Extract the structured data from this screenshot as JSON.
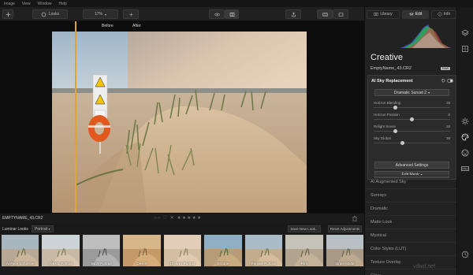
{
  "menu": [
    "Image",
    "View",
    "Window",
    "Help"
  ],
  "toolbar": {
    "looks_label": "Looks",
    "zoom_value": "17%"
  },
  "canvas": {
    "before_label": "Before",
    "after_label": "After"
  },
  "infobar": {
    "filename": "EMPTYNAME_43.CR2",
    "stars": "○– ♡ ✕ ★★★★★"
  },
  "looks": {
    "title": "Luminar Looks",
    "category": "Portrait",
    "save_label": "Save New Look...",
    "reset_label": "Reset Adjustments",
    "items": [
      {
        "label": "AI Face Enhancer"
      },
      {
        "label": "Artistic Portrait"
      },
      {
        "label": "B&W Portrait"
      },
      {
        "label": "Desert"
      },
      {
        "label": "Dreamy Portrait"
      },
      {
        "label": "Escape"
      },
      {
        "label": "Female Portrait"
      },
      {
        "label": "Film"
      },
      {
        "label": "Street Matte"
      }
    ]
  },
  "right_panel": {
    "tabs": {
      "library": "Library",
      "edit": "Edit",
      "info": "Info"
    },
    "title": "Creative",
    "filename": "EmptyName_43.CR2",
    "raw_badge": "RAW",
    "tool": {
      "title": "AI Sky Replacement",
      "preset": "Dramatic Sunset 2",
      "sliders": [
        {
          "label": "Horizon Blending",
          "value": "28",
          "level": 0.28
        },
        {
          "label": "Horizon Position",
          "value": "0",
          "level": 0.5
        },
        {
          "label": "Relight Scene",
          "value": "28",
          "level": 0.28
        },
        {
          "label": "Sky Global",
          "value": "38",
          "level": 0.38
        }
      ],
      "advanced_label": "Advanced Settings",
      "mask_label": "Edit Mask"
    },
    "tools": [
      "AI Augmented Sky",
      "Sunrays",
      "Dramatic",
      "Matte Look",
      "Mystical",
      "Color Styles (LUT)",
      "Texture Overlay",
      "Glow"
    ]
  },
  "watermark": "vdwd.net",
  "colors": {
    "accent": "#e0a530"
  }
}
